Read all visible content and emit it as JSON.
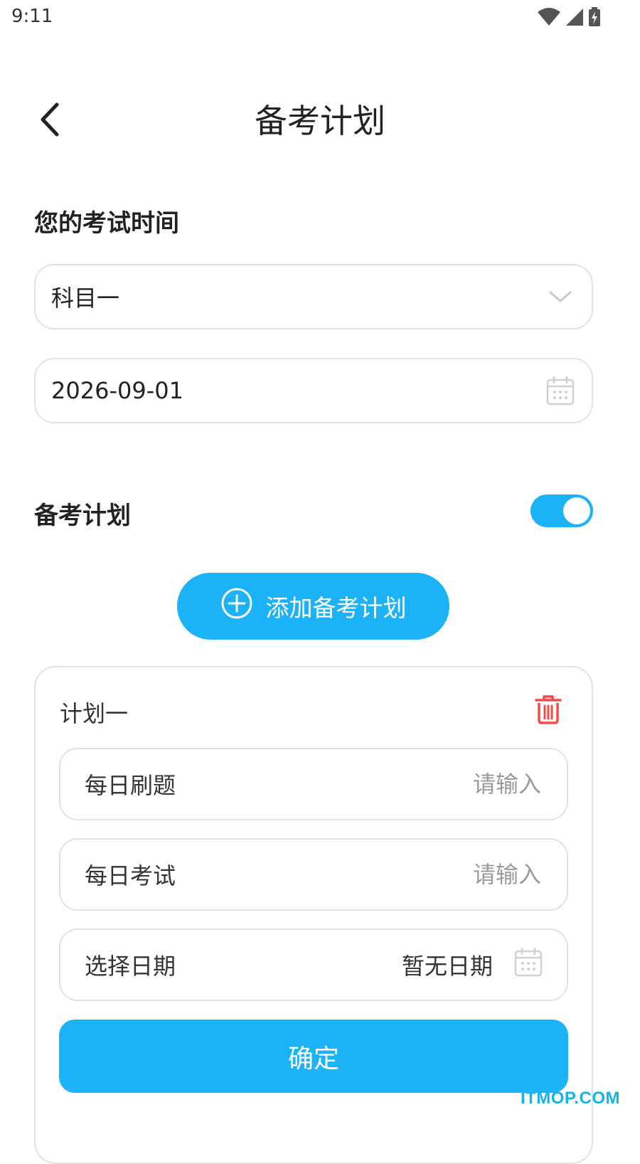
{
  "status_bar": {
    "time": "9:11",
    "icons": [
      "wifi-icon",
      "signal-icon",
      "battery-charging-icon"
    ]
  },
  "header": {
    "title": "备考计划",
    "back_icon": "chevron-left-icon"
  },
  "exam_time_section": {
    "title": "您的考试时间",
    "subject_select": {
      "value": "科目一",
      "icon": "chevron-down-icon"
    },
    "exam_date": {
      "value": "2026-09-01",
      "icon": "calendar-icon"
    }
  },
  "plan_section": {
    "title": "备考计划",
    "toggle_on": true,
    "add_button_label": "添加备考计划",
    "add_icon": "plus-circle-icon"
  },
  "plan_card": {
    "title": "计划一",
    "delete_icon": "trash-icon",
    "daily_practice": {
      "label": "每日刷题",
      "placeholder": "请输入"
    },
    "daily_exam": {
      "label": "每日考试",
      "placeholder": "请输入"
    },
    "date_picker": {
      "label": "选择日期",
      "value": "暂无日期",
      "icon": "calendar-icon"
    },
    "confirm_label": "确定"
  },
  "watermark": "ITMOP.COM",
  "colors": {
    "accent": "#1bb2f8",
    "danger": "#f24b4b",
    "border": "#e2e2e2",
    "placeholder": "#9a9a9a",
    "watermark": "#15b3e6"
  }
}
